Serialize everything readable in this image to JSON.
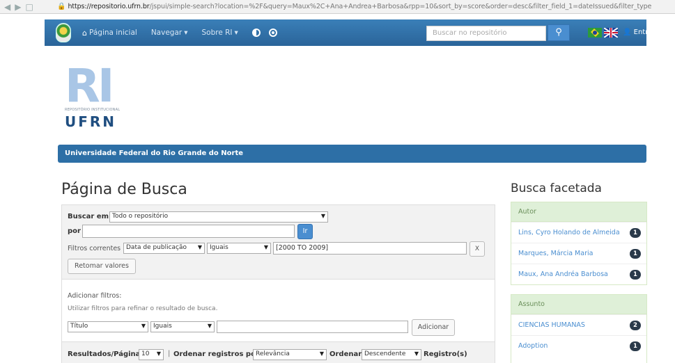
{
  "browser": {
    "url_host": "https://repositorio.ufrn.br",
    "url_rest": "/jspui/simple-search?location=%2F&query=Maux%2C+Ana+Andrea+Barbosa&rpp=10&sort_by=score&order=desc&filter_field_1=dateIssued&filter_type"
  },
  "navbar": {
    "home": "Página inicial",
    "browse": "Navegar",
    "about": "Sobre RI",
    "search_placeholder": "Buscar no repositório",
    "login": "Entrar em"
  },
  "logo": {
    "letters": "RI",
    "small": "REPOSITÓRIO INSTITUCIONAL",
    "name": "UFRN"
  },
  "banner": "Universidade Federal do Rio Grande do Norte",
  "page_title": "Página de Busca",
  "search": {
    "search_in_label": "Buscar em:",
    "scope": "Todo o repositório",
    "for_label": "por",
    "query": "",
    "go_button": "Ir",
    "current_filters_label": "Filtros correntes",
    "filter_field": "Data de publicação",
    "filter_op": "Iguais",
    "filter_value": "[2000 TO 2009]",
    "remove_button": "X",
    "reset_button": "Retomar valores"
  },
  "add_filters": {
    "title": "Adicionar filtros:",
    "hint": "Utilizar filtros para refinar o resultado de busca.",
    "field": "Título",
    "op": "Iguais",
    "value": "",
    "add_button": "Adicionar"
  },
  "results_bar": {
    "per_page_label": "Resultados/Página",
    "per_page": "10",
    "sort_label": "Ordenar registros por",
    "sort_by": "Relevância",
    "order_label": "Ordenar",
    "order": "Descendente",
    "records_label": "Registro(s)"
  },
  "facets": {
    "title": "Busca facetada",
    "author": {
      "heading": "Autor",
      "items": [
        {
          "label": "Lins, Cyro Holando de Almeida",
          "count": "1"
        },
        {
          "label": "Marques, Márcia Maria",
          "count": "1"
        },
        {
          "label": "Maux, Ana Andréa Barbosa",
          "count": "1"
        }
      ]
    },
    "subject": {
      "heading": "Assunto",
      "items": [
        {
          "label": "CIENCIAS HUMANAS",
          "count": "2"
        },
        {
          "label": "Adoption",
          "count": "1"
        }
      ]
    }
  }
}
